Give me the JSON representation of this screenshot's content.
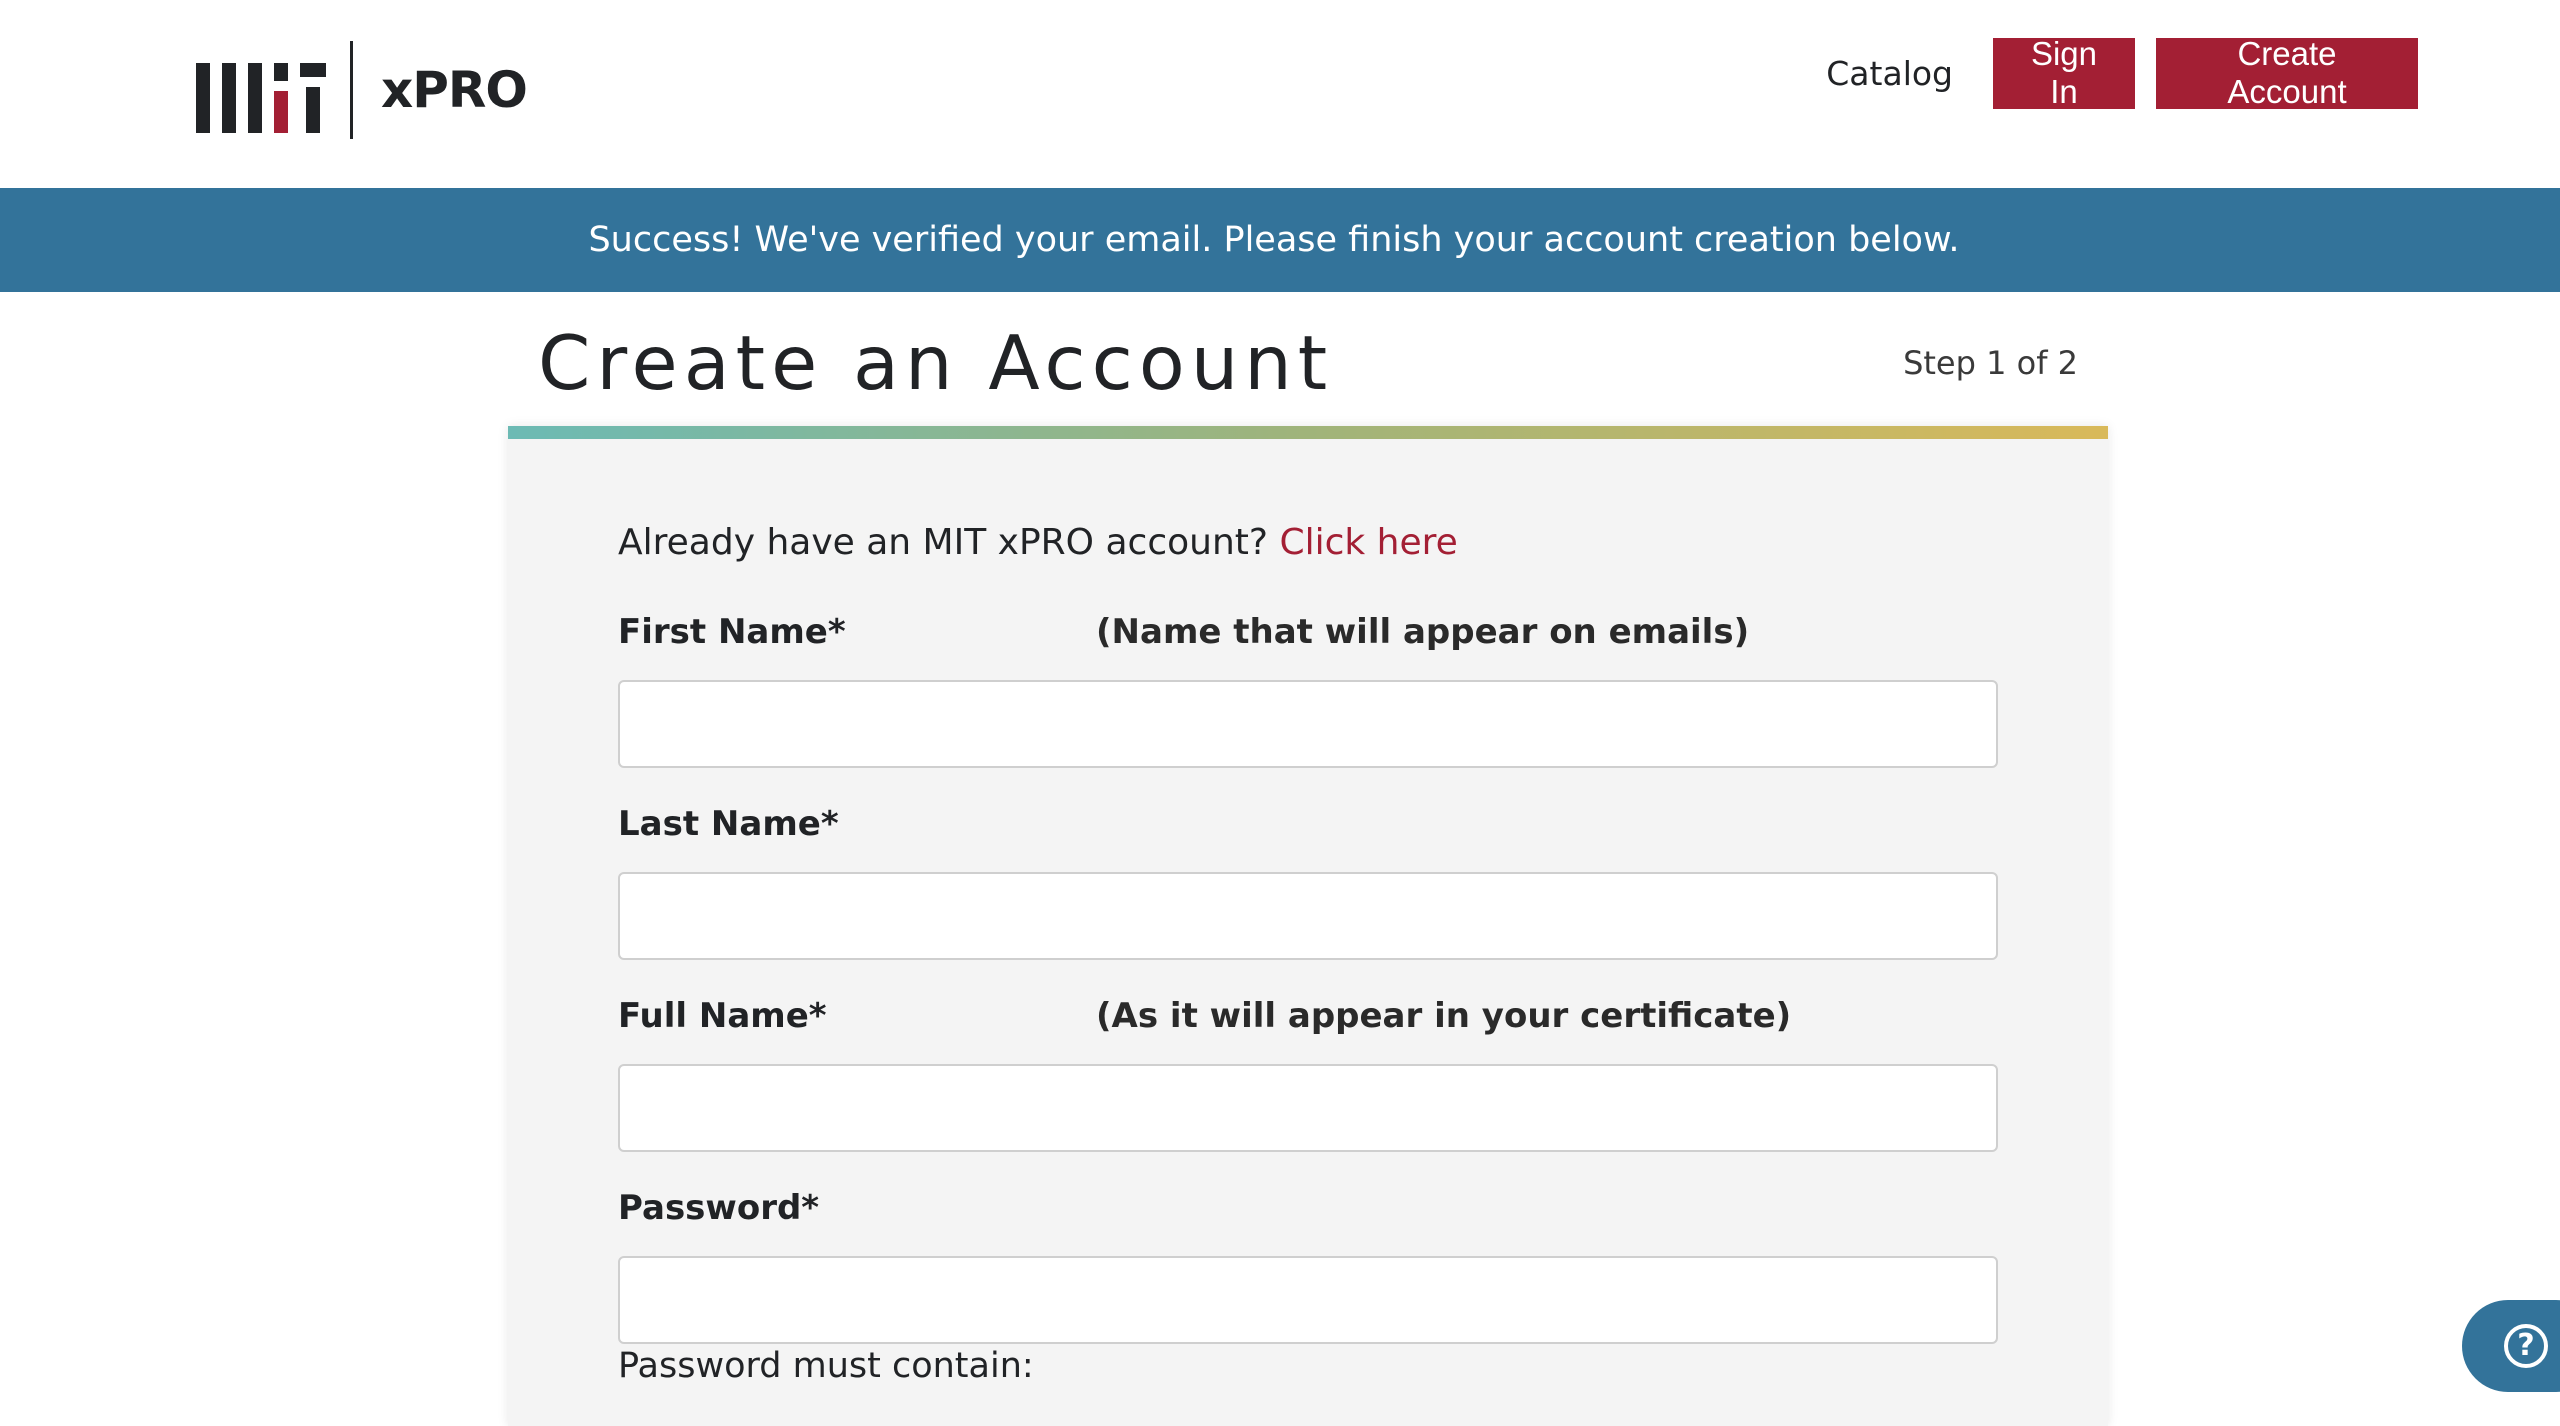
{
  "header": {
    "logo_text": "xPRO",
    "nav": {
      "catalog_label": "Catalog",
      "signin_label": "Sign In",
      "create_account_label": "Create Account"
    }
  },
  "banner": {
    "message": "Success! We've verified your email. Please finish your account creation below."
  },
  "page": {
    "title": "Create an Account",
    "step": "Step 1 of 2"
  },
  "form": {
    "already_text": "Already have an MIT xPRO account?",
    "already_link": "Click here",
    "first_name": {
      "label": "First Name*",
      "hint": "(Name that will appear on emails)",
      "value": ""
    },
    "last_name": {
      "label": "Last Name*",
      "value": ""
    },
    "full_name": {
      "label": "Full Name*",
      "hint": "(As it will appear in your certificate)",
      "value": ""
    },
    "password": {
      "label": "Password*",
      "value": ""
    },
    "password_note": "Password must contain:"
  },
  "colors": {
    "brand_red": "#a31f34",
    "banner_blue": "#33739a"
  },
  "icons": {
    "help": "question-circle-icon"
  }
}
